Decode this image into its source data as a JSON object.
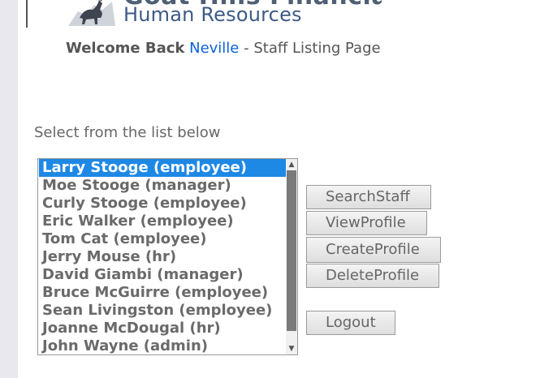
{
  "logo": {
    "company": "Goat Hills Financial",
    "department": "Human Resources"
  },
  "welcome": {
    "prefix": "Welcome Back",
    "user": "Neville",
    "suffix": "- Staff Listing Page"
  },
  "instruction": "Select from the list below",
  "staff_list": {
    "selected_index": 0,
    "items": [
      "Larry Stooge (employee)",
      "Moe Stooge (manager)",
      "Curly Stooge (employee)",
      "Eric Walker (employee)",
      "Tom Cat (employee)",
      "Jerry Mouse (hr)",
      "David Giambi (manager)",
      "Bruce McGuirre (employee)",
      "Sean Livingston (employee)",
      "Joanne McDougal (hr)",
      "John Wayne (admin)"
    ]
  },
  "buttons": {
    "search": "SearchStaff",
    "view": "ViewProfile",
    "create": "CreateProfile",
    "delete": "DeleteProfile",
    "logout": "Logout"
  },
  "colors": {
    "selection": "#1e88e5",
    "user_link": "#0b63d9"
  },
  "icons": {
    "logo": "goat-logo-icon",
    "scroll_up": "chevron-up-icon",
    "scroll_down": "chevron-down-icon"
  }
}
